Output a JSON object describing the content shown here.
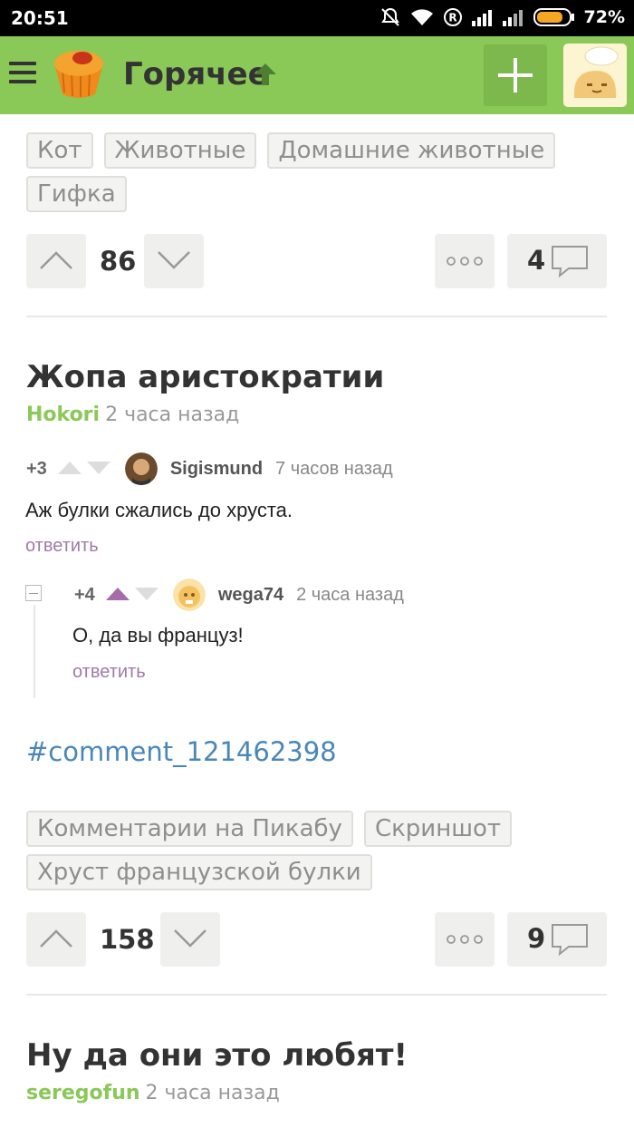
{
  "status_bar": {
    "time": "20:51",
    "battery": "72%"
  },
  "app_bar": {
    "title": "Горячее"
  },
  "post1": {
    "tags": [
      "Кот",
      "Животные",
      "Домашние животные",
      "Гифка"
    ],
    "rating": "86",
    "comments_count": "4"
  },
  "post2": {
    "title": "Жопа аристократии",
    "author": "Hokori",
    "time": "2 часа назад",
    "screenshot": {
      "comment1": {
        "score": "+3",
        "user": "Sigismund",
        "time": "7 часов назад",
        "text": "Аж булки сжались до хруста.",
        "reply": "ответить"
      },
      "comment2": {
        "score": "+4",
        "user": "wega74",
        "time": "2 часа назад",
        "text": "О, да вы француз!",
        "reply": "ответить"
      }
    },
    "link": "#comment_121462398",
    "tags": [
      "Комментарии на Пикабу",
      "Скриншот",
      "Хруст французской булки"
    ],
    "rating": "158",
    "comments_count": "9"
  },
  "post3": {
    "title": "Ну да они это любят!",
    "author": "seregofun",
    "time": "2 часа назад"
  },
  "colors": {
    "brand": "#8ac858",
    "link": "#4a87b8",
    "reply": "#a07aa8"
  }
}
